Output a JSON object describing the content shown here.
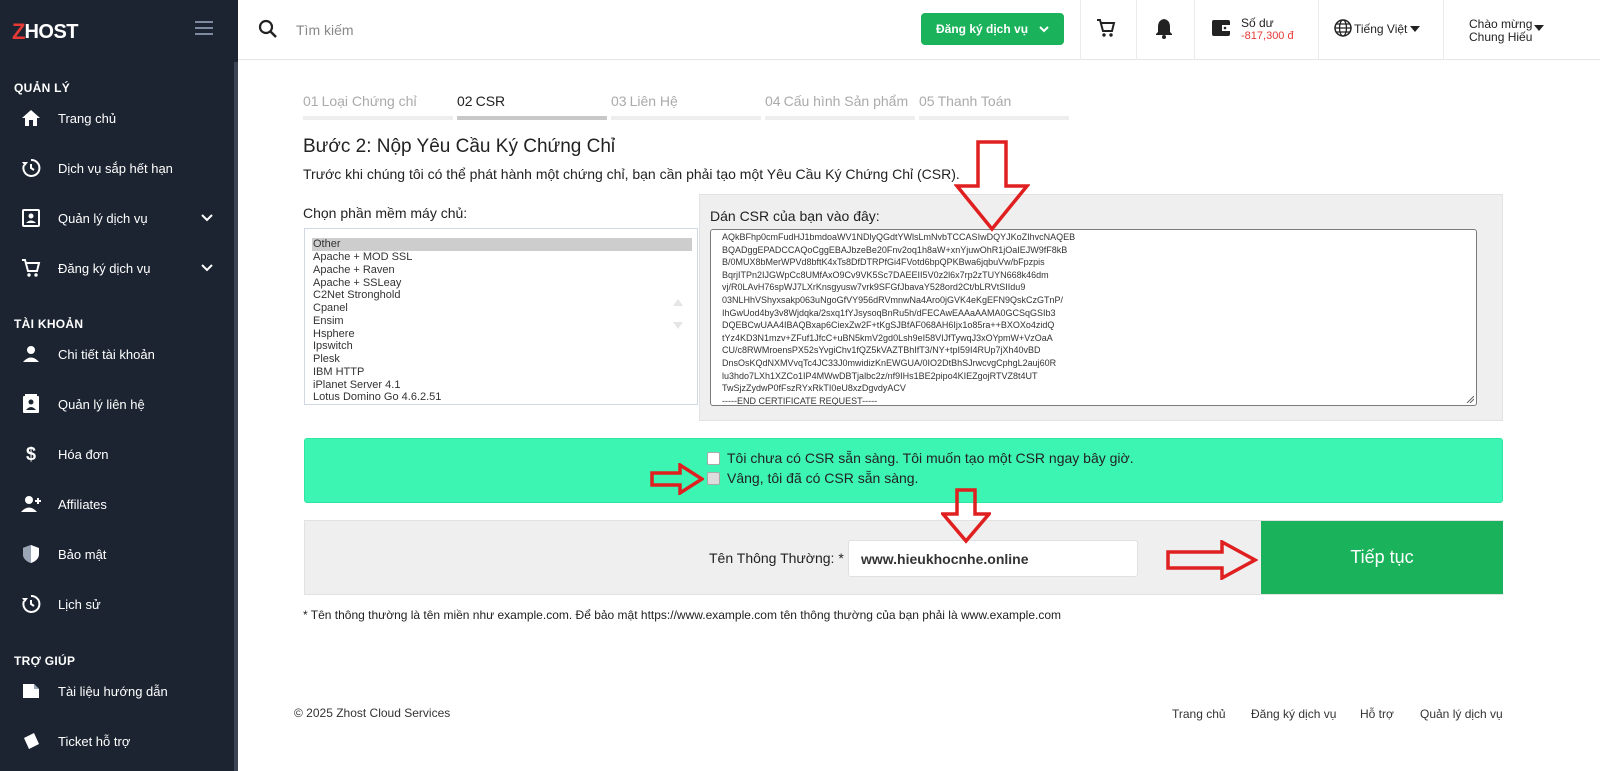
{
  "sidebar": {
    "logo": {
      "z": "Z",
      "rest": "HOST"
    },
    "sections": {
      "manage": "QUẢN LÝ",
      "account": "TÀI KHOẢN",
      "help": "TRỢ GIÚP"
    },
    "items": [
      {
        "label": "Trang chủ",
        "icon": "home-icon"
      },
      {
        "label": "Dịch vụ sắp hết hạn",
        "icon": "history-icon"
      },
      {
        "label": "Quản lý dịch vụ",
        "icon": "account-box-icon"
      },
      {
        "label": "Đăng ký dịch vụ",
        "icon": "cart-icon"
      },
      {
        "label": "Chi tiết tài khoản",
        "icon": "person-icon"
      },
      {
        "label": "Quản lý liên hệ",
        "icon": "contacts-icon"
      },
      {
        "label": "Hóa đơn",
        "icon": "dollar-icon"
      },
      {
        "label": "Affiliates",
        "icon": "person-add-icon"
      },
      {
        "label": "Bảo mật",
        "icon": "shield-icon"
      },
      {
        "label": "Lịch sử",
        "icon": "history-icon"
      },
      {
        "label": "Tài liệu hướng dẫn",
        "icon": "document-icon"
      },
      {
        "label": "Ticket hỗ trợ",
        "icon": "ticket-icon"
      }
    ]
  },
  "topbar": {
    "search_placeholder": "Tìm kiếm",
    "register_button": "Đăng ký dịch vụ",
    "balance_label": "Số dư",
    "balance_value": "-817,300 đ",
    "language": "Tiếng Việt",
    "greeting_line1": "Chào mừng",
    "greeting_line2": "Chung Hiếu"
  },
  "steps": [
    {
      "num": "01",
      "label": "Loại Chứng chỉ",
      "active": false
    },
    {
      "num": "02",
      "label": "CSR",
      "active": true
    },
    {
      "num": "03",
      "label": "Liên Hệ",
      "active": false
    },
    {
      "num": "04",
      "label": "Cấu hình Sản phẩm",
      "active": false
    },
    {
      "num": "05",
      "label": "Thanh Toán",
      "active": false
    }
  ],
  "main": {
    "title": "Bước 2: Nộp Yêu Cầu Ký Chứng Chỉ",
    "intro": "Trước khi chúng tôi có thể phát hành một chứng chỉ, bạn cần phải tạo một Yêu Cầu Ký Chứng Chỉ (CSR).",
    "server_label": "Chọn phần mềm máy chủ:",
    "server_options": [
      "Other",
      "Apache + MOD SSL",
      "Apache + Raven",
      "Apache + SSLeay",
      "C2Net Stronghold",
      "Cpanel",
      "Ensim",
      "Hsphere",
      "Ipswitch",
      "Plesk",
      "IBM HTTP",
      "iPlanet Server 4.1",
      "Lotus Domino Go 4.6.2.51"
    ],
    "server_selected": "Other",
    "csr_label": "Dán CSR của bạn vào đây:",
    "csr_lines": [
      "AQkBFhp0cmFudHJ1bmdoaWV1NDlyQGdtYWlsLmNvbTCCASIwDQYJKoZIhvcNAQEB",
      "BQADggEPADCCAQoCggEBAJbzeBe20Fnv2oq1h8aW+xnYjuwOhR1jOaIEJW9fF8kB",
      "B/0MUX8bMerWPVd8bftK4xTs8DfDTRPfGi4FVotd6bpQPKBwa6jqbuVw/bFpzpis",
      "BqrjITPn2IJGWpCc8UMfAxO9Cv9VK5Sc7DAEEII5V0z2l6x7rp2zTUYN668k46dm",
      "vj/R0LAvH76spWJ7LXrKnsgyusw7vrk9SFGfJbavaY528ord2Ct/bLRVtSIIdu9",
      "03NLHhVShyxsakp063uNgoGfVY956dRVmnwNa4Aro0jGVK4eKgEFN9QskCzGTnP/",
      "IhGwUod4by3v8Wjdqka/2sxq1fYJsysoqBnRu5h/dFECAwEAAaAAMA0GCSqGSIb3",
      "DQEBCwUAA4IBAQBxap6CiexZw2F+tKgSJBfAF068AH6Ijx1o85ra++BXOXo4zidQ",
      "tYz4KD3N1mzv+ZFuf1JfcC+uBN5kmV2gd0Lsh9eI58VIJfTywqJ3xOYpmW+VzOaA",
      "CU/c8RWMroensPX52sYvgiChv1fQZ5kVAZTBhIfT3/NY+tpI59I4RUp7jXh40vBD",
      "DnsOsKQdNXMVvqTc4JC33J0mwidizKnEWGUA/0IO2DtBhSJrwcvgCphgL2auj60R",
      "lu3hdo7LXh1XZCo1IP4MWwDBTjalbc2z/nf9IHs1BE2pipo4KIEZgojRTVZ8t4UT",
      "TwSjzZydwP0fFszRYxRkTI0eU8xzDgvdyACV",
      "-----END CERTIFICATE REQUEST-----"
    ],
    "option_no": "Tôi chưa có CSR sẵn sàng. Tôi muốn tạo một CSR ngay bây giờ.",
    "option_yes": "Vâng, tôi đã có CSR sẵn sàng.",
    "common_name_label": "Tên Thông Thường: *",
    "common_name_value": "www.hieukhocnhe.online",
    "continue_button": "Tiếp tục",
    "note": "* Tên thông thường là tên miền như example.com. Để bảo mật https://www.example.com tên thông thường của bạn phải là www.example.com"
  },
  "footer": {
    "copyright": "© 2025 Zhost Cloud Services",
    "links": [
      "Trang chủ",
      "Đăng ký dịch vụ",
      "Hỗ trợ",
      "Quản lý dịch vụ"
    ]
  },
  "colors": {
    "sidebar_bg": "#1c2431",
    "accent_green": "#1ab35b",
    "option_box": "#3df5b2",
    "balance_red": "#e53935",
    "annotation_red": "#e02020"
  }
}
